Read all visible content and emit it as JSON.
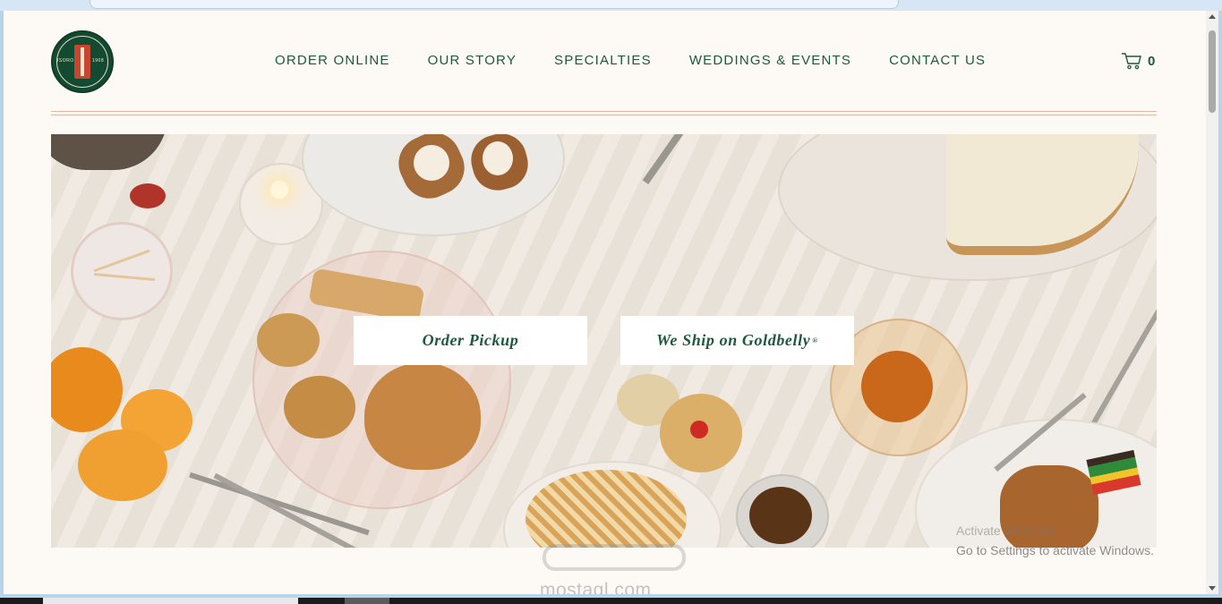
{
  "header": {
    "logo": {
      "year_left": "ISORO",
      "year_right": "1908"
    },
    "nav": [
      {
        "label": "ORDER ONLINE"
      },
      {
        "label": "OUR STORY"
      },
      {
        "label": "SPECIALTIES"
      },
      {
        "label": "WEDDINGS & EVENTS"
      },
      {
        "label": "CONTACT US"
      }
    ],
    "cart": {
      "icon": "cart-icon",
      "count": "0"
    }
  },
  "hero": {
    "buttons": {
      "pickup": "Order Pickup",
      "goldbelly": "We Ship on Goldbelly",
      "goldbelly_mark": "®"
    }
  },
  "overlays": {
    "activate_title": "Activate Windows",
    "activate_sub": "Go to Settings to activate Windows.",
    "watermark_domain": "mostaql.com"
  },
  "colors": {
    "brand_green": "#1c5a3b",
    "logo_red": "#c8452f",
    "page_bg": "#fdf9f5",
    "divider": "#e2b7a4"
  }
}
